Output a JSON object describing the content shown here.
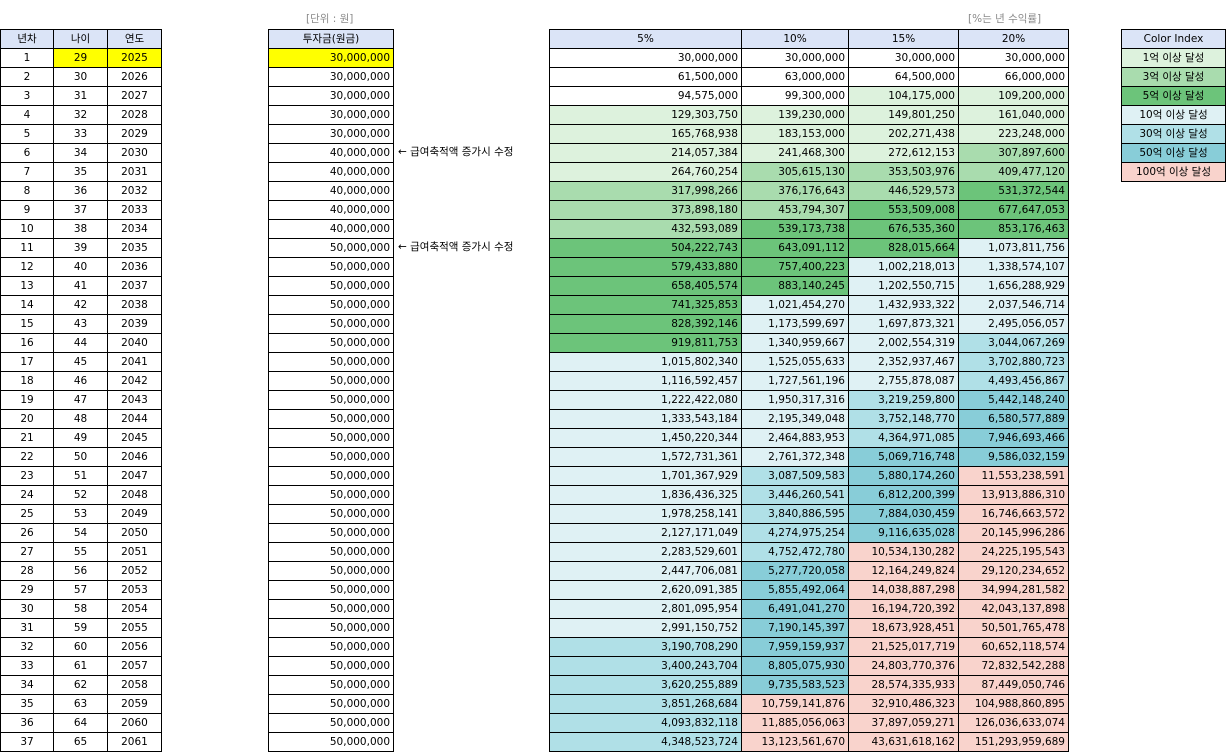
{
  "captions": {
    "unit": "[단위 : 원]",
    "percent": "[%는 년 수익률]"
  },
  "headers": {
    "years": [
      "년차",
      "나이",
      "연도"
    ],
    "invest": "투자금(원금)",
    "returns": [
      "5%",
      "10%",
      "15%",
      "20%"
    ],
    "legend": "Color Index"
  },
  "notes": [
    "← 급여축적액 증가시 수정",
    "← 급여축적액 증가시 수정"
  ],
  "colors": {
    "header_bg": "#dbe4f7",
    "highlight_yellow": "#ffff00",
    "over_100m": "#ddf2dd",
    "over_300m": "#a9dcae",
    "over_500m": "#6cc47a",
    "over_1b": "#dff1f4",
    "over_3b": "#b0e0e7",
    "over_5b": "#88cdd8",
    "over_10b": "#f9d3cc"
  },
  "legend": [
    {
      "label": "1억 이상 달성",
      "color": "#ddf2dd"
    },
    {
      "label": "3억 이상 달성",
      "color": "#a9dcae"
    },
    {
      "label": "5억 이상 달성",
      "color": "#6cc47a"
    },
    {
      "label": "10억 이상 달성",
      "color": "#dff1f4"
    },
    {
      "label": "30억 이상 달성",
      "color": "#b0e0e7"
    },
    {
      "label": "50억 이상 달성",
      "color": "#88cdd8"
    },
    {
      "label": "100억 이상 달성",
      "color": "#f9d3cc"
    }
  ],
  "rows": [
    {
      "n": "1",
      "age": "29",
      "year": "2025",
      "invest": "30,000,000",
      "r": [
        "30,000,000",
        "30,000,000",
        "30,000,000",
        "30,000,000"
      ]
    },
    {
      "n": "2",
      "age": "30",
      "year": "2026",
      "invest": "30,000,000",
      "r": [
        "61,500,000",
        "63,000,000",
        "64,500,000",
        "66,000,000"
      ]
    },
    {
      "n": "3",
      "age": "31",
      "year": "2027",
      "invest": "30,000,000",
      "r": [
        "94,575,000",
        "99,300,000",
        "104,175,000",
        "109,200,000"
      ]
    },
    {
      "n": "4",
      "age": "32",
      "year": "2028",
      "invest": "30,000,000",
      "r": [
        "129,303,750",
        "139,230,000",
        "149,801,250",
        "161,040,000"
      ]
    },
    {
      "n": "5",
      "age": "33",
      "year": "2029",
      "invest": "30,000,000",
      "r": [
        "165,768,938",
        "183,153,000",
        "202,271,438",
        "223,248,000"
      ]
    },
    {
      "n": "6",
      "age": "34",
      "year": "2030",
      "invest": "40,000,000",
      "r": [
        "214,057,384",
        "241,468,300",
        "272,612,153",
        "307,897,600"
      ]
    },
    {
      "n": "7",
      "age": "35",
      "year": "2031",
      "invest": "40,000,000",
      "r": [
        "264,760,254",
        "305,615,130",
        "353,503,976",
        "409,477,120"
      ]
    },
    {
      "n": "8",
      "age": "36",
      "year": "2032",
      "invest": "40,000,000",
      "r": [
        "317,998,266",
        "376,176,643",
        "446,529,573",
        "531,372,544"
      ]
    },
    {
      "n": "9",
      "age": "37",
      "year": "2033",
      "invest": "40,000,000",
      "r": [
        "373,898,180",
        "453,794,307",
        "553,509,008",
        "677,647,053"
      ]
    },
    {
      "n": "10",
      "age": "38",
      "year": "2034",
      "invest": "40,000,000",
      "r": [
        "432,593,089",
        "539,173,738",
        "676,535,360",
        "853,176,463"
      ]
    },
    {
      "n": "11",
      "age": "39",
      "year": "2035",
      "invest": "50,000,000",
      "r": [
        "504,222,743",
        "643,091,112",
        "828,015,664",
        "1,073,811,756"
      ]
    },
    {
      "n": "12",
      "age": "40",
      "year": "2036",
      "invest": "50,000,000",
      "r": [
        "579,433,880",
        "757,400,223",
        "1,002,218,013",
        "1,338,574,107"
      ]
    },
    {
      "n": "13",
      "age": "41",
      "year": "2037",
      "invest": "50,000,000",
      "r": [
        "658,405,574",
        "883,140,245",
        "1,202,550,715",
        "1,656,288,929"
      ]
    },
    {
      "n": "14",
      "age": "42",
      "year": "2038",
      "invest": "50,000,000",
      "r": [
        "741,325,853",
        "1,021,454,270",
        "1,432,933,322",
        "2,037,546,714"
      ]
    },
    {
      "n": "15",
      "age": "43",
      "year": "2039",
      "invest": "50,000,000",
      "r": [
        "828,392,146",
        "1,173,599,697",
        "1,697,873,321",
        "2,495,056,057"
      ]
    },
    {
      "n": "16",
      "age": "44",
      "year": "2040",
      "invest": "50,000,000",
      "r": [
        "919,811,753",
        "1,340,959,667",
        "2,002,554,319",
        "3,044,067,269"
      ]
    },
    {
      "n": "17",
      "age": "45",
      "year": "2041",
      "invest": "50,000,000",
      "r": [
        "1,015,802,340",
        "1,525,055,633",
        "2,352,937,467",
        "3,702,880,723"
      ]
    },
    {
      "n": "18",
      "age": "46",
      "year": "2042",
      "invest": "50,000,000",
      "r": [
        "1,116,592,457",
        "1,727,561,196",
        "2,755,878,087",
        "4,493,456,867"
      ]
    },
    {
      "n": "19",
      "age": "47",
      "year": "2043",
      "invest": "50,000,000",
      "r": [
        "1,222,422,080",
        "1,950,317,316",
        "3,219,259,800",
        "5,442,148,240"
      ]
    },
    {
      "n": "20",
      "age": "48",
      "year": "2044",
      "invest": "50,000,000",
      "r": [
        "1,333,543,184",
        "2,195,349,048",
        "3,752,148,770",
        "6,580,577,889"
      ]
    },
    {
      "n": "21",
      "age": "49",
      "year": "2045",
      "invest": "50,000,000",
      "r": [
        "1,450,220,344",
        "2,464,883,953",
        "4,364,971,085",
        "7,946,693,466"
      ]
    },
    {
      "n": "22",
      "age": "50",
      "year": "2046",
      "invest": "50,000,000",
      "r": [
        "1,572,731,361",
        "2,761,372,348",
        "5,069,716,748",
        "9,586,032,159"
      ]
    },
    {
      "n": "23",
      "age": "51",
      "year": "2047",
      "invest": "50,000,000",
      "r": [
        "1,701,367,929",
        "3,087,509,583",
        "5,880,174,260",
        "11,553,238,591"
      ]
    },
    {
      "n": "24",
      "age": "52",
      "year": "2048",
      "invest": "50,000,000",
      "r": [
        "1,836,436,325",
        "3,446,260,541",
        "6,812,200,399",
        "13,913,886,310"
      ]
    },
    {
      "n": "25",
      "age": "53",
      "year": "2049",
      "invest": "50,000,000",
      "r": [
        "1,978,258,141",
        "3,840,886,595",
        "7,884,030,459",
        "16,746,663,572"
      ]
    },
    {
      "n": "26",
      "age": "54",
      "year": "2050",
      "invest": "50,000,000",
      "r": [
        "2,127,171,049",
        "4,274,975,254",
        "9,116,635,028",
        "20,145,996,286"
      ]
    },
    {
      "n": "27",
      "age": "55",
      "year": "2051",
      "invest": "50,000,000",
      "r": [
        "2,283,529,601",
        "4,752,472,780",
        "10,534,130,282",
        "24,225,195,543"
      ]
    },
    {
      "n": "28",
      "age": "56",
      "year": "2052",
      "invest": "50,000,000",
      "r": [
        "2,447,706,081",
        "5,277,720,058",
        "12,164,249,824",
        "29,120,234,652"
      ]
    },
    {
      "n": "29",
      "age": "57",
      "year": "2053",
      "invest": "50,000,000",
      "r": [
        "2,620,091,385",
        "5,855,492,064",
        "14,038,887,298",
        "34,994,281,582"
      ]
    },
    {
      "n": "30",
      "age": "58",
      "year": "2054",
      "invest": "50,000,000",
      "r": [
        "2,801,095,954",
        "6,491,041,270",
        "16,194,720,392",
        "42,043,137,898"
      ]
    },
    {
      "n": "31",
      "age": "59",
      "year": "2055",
      "invest": "50,000,000",
      "r": [
        "2,991,150,752",
        "7,190,145,397",
        "18,673,928,451",
        "50,501,765,478"
      ]
    },
    {
      "n": "32",
      "age": "60",
      "year": "2056",
      "invest": "50,000,000",
      "r": [
        "3,190,708,290",
        "7,959,159,937",
        "21,525,017,719",
        "60,652,118,574"
      ]
    },
    {
      "n": "33",
      "age": "61",
      "year": "2057",
      "invest": "50,000,000",
      "r": [
        "3,400,243,704",
        "8,805,075,930",
        "24,803,770,376",
        "72,832,542,288"
      ]
    },
    {
      "n": "34",
      "age": "62",
      "year": "2058",
      "invest": "50,000,000",
      "r": [
        "3,620,255,889",
        "9,735,583,523",
        "28,574,335,933",
        "87,449,050,746"
      ]
    },
    {
      "n": "35",
      "age": "63",
      "year": "2059",
      "invest": "50,000,000",
      "r": [
        "3,851,268,684",
        "10,759,141,876",
        "32,910,486,323",
        "104,988,860,895"
      ]
    },
    {
      "n": "36",
      "age": "64",
      "year": "2060",
      "invest": "50,000,000",
      "r": [
        "4,093,832,118",
        "11,885,056,063",
        "37,897,059,271",
        "126,036,633,074"
      ]
    },
    {
      "n": "37",
      "age": "65",
      "year": "2061",
      "invest": "50,000,000",
      "r": [
        "4,348,523,724",
        "13,123,561,670",
        "43,631,618,162",
        "151,293,959,689"
      ]
    }
  ]
}
